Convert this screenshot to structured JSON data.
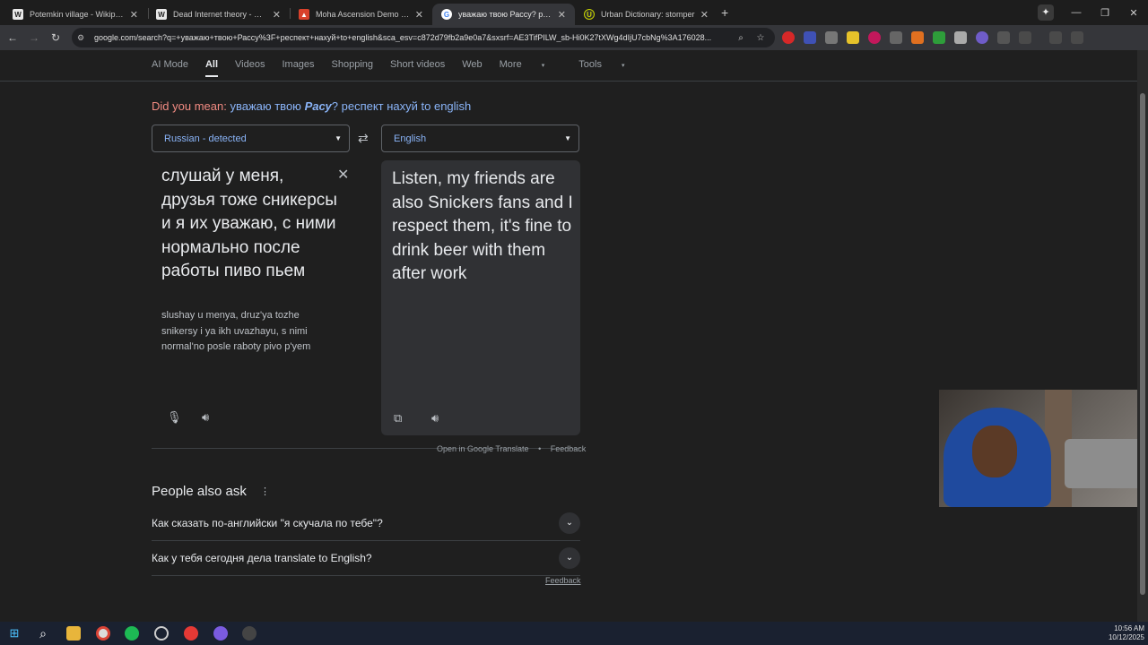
{
  "tabs": [
    {
      "title": "Potemkin village - Wikipedia",
      "icon": "W",
      "active": false
    },
    {
      "title": "Dead Internet theory - Wikipedia",
      "icon": "W",
      "active": false
    },
    {
      "title": "Moha Ascension Demo results",
      "icon": "flag-icon",
      "active": false
    },
    {
      "title": "уважаю твою Рассу? респект",
      "icon": "google-icon",
      "active": true
    },
    {
      "title": "Urban Dictionary: stomper",
      "icon": "urban-dictionary-icon",
      "active": false
    }
  ],
  "address_bar": {
    "url": "google.com/search?q=+уважаю+твою+Рассу%3F+респект+нахуй+to+english&sca_esv=c872d79fb2a9e0a7&sxsrf=AE3TifPILW_sb-Hi0K27tXWg4dIjU7cbNg%3A176028..."
  },
  "profile_initial": "A",
  "search_tabs": [
    "AI Mode",
    "All",
    "Videos",
    "Images",
    "Shopping",
    "Short videos",
    "Web",
    "More",
    "Tools"
  ],
  "did_you_mean": {
    "label": "Did you mean:",
    "pre": "уважаю твою",
    "bold": "Расу",
    "post": "? респект нахуй to english"
  },
  "translator": {
    "source_lang": "Russian - detected",
    "target_lang": "English",
    "source_text": "слушай у меня, друзья тоже сникерсы и я их уважаю, с ними нормально после работы пиво пьем",
    "transliteration": "slushay u menya, druz'ya tozhe snikersy i ya ikh uvazhayu, s nimi normal'no posle raboty pivo p'yem",
    "target_text": "Listen, my friends are also Snickers fans and I respect them, it's fine to drink beer with them after work",
    "open_link": "Open in Google Translate",
    "separator": "•",
    "feedback": "Feedback"
  },
  "people_also_ask": {
    "title": "People also ask",
    "questions": [
      "Как сказать по-английски \"я скучала по тебе\"?",
      "Как у тебя сегодня дела translate to English?"
    ],
    "feedback": "Feedback"
  },
  "taskbar": {
    "time": "10:56 AM",
    "date": "10/12/2025"
  },
  "colors": {
    "page_bg": "#1f1f1f",
    "link_blue": "#8ab4f8",
    "did_you_mean_red": "#f28b82",
    "card_bg": "#303134"
  }
}
